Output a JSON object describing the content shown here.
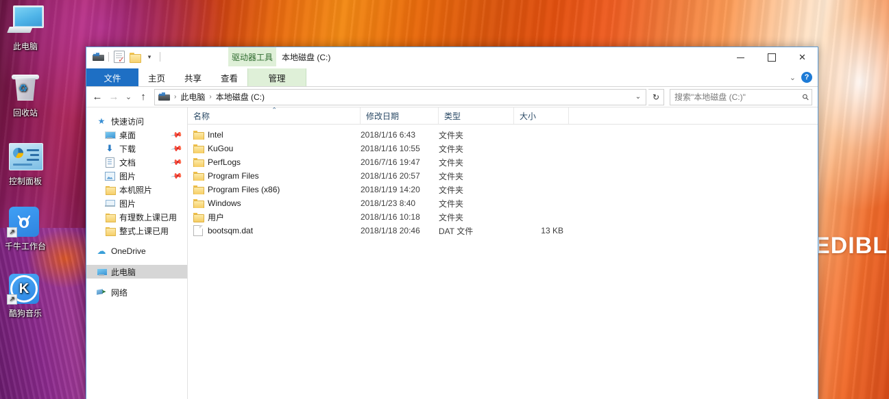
{
  "desktop": {
    "wallpaper_text": "EDIBLE",
    "icons": [
      {
        "label": "此电脑",
        "icon": "this-pc-icon"
      },
      {
        "label": "回收站",
        "icon": "recycle-bin-icon"
      },
      {
        "label": "控制面板",
        "icon": "control-panel-icon"
      },
      {
        "label": "千牛工作台",
        "icon": "qianniu-app-icon"
      },
      {
        "label": "酷狗音乐",
        "icon": "kugou-music-icon"
      }
    ]
  },
  "window": {
    "title": "本地磁盘 (C:)",
    "contextual_tab_group": "驱动器工具",
    "quick_access_toolbar": [
      {
        "name": "drive-icon",
        "label": "驱动器"
      },
      {
        "name": "properties-icon",
        "label": "属性"
      },
      {
        "name": "new-folder-icon",
        "label": "新建文件夹"
      },
      {
        "name": "customize-dropdown-icon",
        "label": "自定义快速访问工具栏"
      }
    ],
    "controls": {
      "minimize": "最小化",
      "maximize": "最大化",
      "close": "关闭",
      "collapse_ribbon": "折叠功能区",
      "help": "?"
    },
    "tabs": [
      {
        "label": "文件",
        "state": "file"
      },
      {
        "label": "主页",
        "state": "normal"
      },
      {
        "label": "共享",
        "state": "normal"
      },
      {
        "label": "查看",
        "state": "normal"
      },
      {
        "label": "管理",
        "state": "contextual"
      }
    ]
  },
  "addressbar": {
    "back": "←",
    "forward": "→",
    "recent": "⌄",
    "up": "↑",
    "breadcrumbs": [
      "此电脑",
      "本地磁盘 (C:)"
    ],
    "separator": "›",
    "dropdown": "⌄",
    "refresh": "↻",
    "search_placeholder": "搜索\"本地磁盘 (C:)\"",
    "search_value": "",
    "search_icon": "search-icon"
  },
  "navpane": {
    "groups": [
      {
        "header": {
          "label": "快速访问",
          "icon": "star-icon"
        },
        "items": [
          {
            "label": "桌面",
            "icon": "desktop-icon",
            "pinned": true
          },
          {
            "label": "下载",
            "icon": "downloads-icon",
            "pinned": true
          },
          {
            "label": "文档",
            "icon": "documents-icon",
            "pinned": true
          },
          {
            "label": "图片",
            "icon": "pictures-icon",
            "pinned": true
          },
          {
            "label": "本机照片",
            "icon": "folder-icon",
            "pinned": false
          },
          {
            "label": "图片",
            "icon": "laptop-icon",
            "pinned": false
          },
          {
            "label": "有理数上课已用",
            "icon": "folder-icon",
            "pinned": false
          },
          {
            "label": "整式上课已用",
            "icon": "folder-icon",
            "pinned": false
          }
        ]
      },
      {
        "header": null,
        "items": [
          {
            "label": "OneDrive",
            "icon": "cloud-icon",
            "pinned": false,
            "selected": false
          },
          {
            "label": "此电脑",
            "icon": "this-pc-icon",
            "pinned": false,
            "selected": true
          },
          {
            "label": "网络",
            "icon": "network-icon",
            "pinned": false,
            "selected": false
          }
        ]
      }
    ]
  },
  "filelist": {
    "columns": [
      {
        "label": "名称",
        "key": "name",
        "sorted": "asc"
      },
      {
        "label": "修改日期",
        "key": "date",
        "sorted": null
      },
      {
        "label": "类型",
        "key": "type",
        "sorted": null
      },
      {
        "label": "大小",
        "key": "size",
        "sorted": null
      }
    ],
    "sort_caret": "⌃",
    "rows": [
      {
        "name": "Intel",
        "date": "2018/1/16 6:43",
        "type": "文件夹",
        "size": "",
        "icon": "folder-icon"
      },
      {
        "name": "KuGou",
        "date": "2018/1/16 10:55",
        "type": "文件夹",
        "size": "",
        "icon": "folder-icon"
      },
      {
        "name": "PerfLogs",
        "date": "2016/7/16 19:47",
        "type": "文件夹",
        "size": "",
        "icon": "folder-icon"
      },
      {
        "name": "Program Files",
        "date": "2018/1/16 20:57",
        "type": "文件夹",
        "size": "",
        "icon": "folder-icon"
      },
      {
        "name": "Program Files (x86)",
        "date": "2018/1/19 14:20",
        "type": "文件夹",
        "size": "",
        "icon": "folder-icon"
      },
      {
        "name": "Windows",
        "date": "2018/1/23 8:40",
        "type": "文件夹",
        "size": "",
        "icon": "folder-icon"
      },
      {
        "name": "用户",
        "date": "2018/1/16 10:18",
        "type": "文件夹",
        "size": "",
        "icon": "folder-icon"
      },
      {
        "name": "bootsqm.dat",
        "date": "2018/1/18 20:46",
        "type": "DAT 文件",
        "size": "13 KB",
        "icon": "file-icon"
      }
    ]
  },
  "colors": {
    "file_tab_blue": "#1e6fc4",
    "contextual_green": "#dff0d8",
    "selection_grey": "#d6d6d6",
    "window_border": "#5b9bd5",
    "folder_yellow": "#f6cd63"
  }
}
